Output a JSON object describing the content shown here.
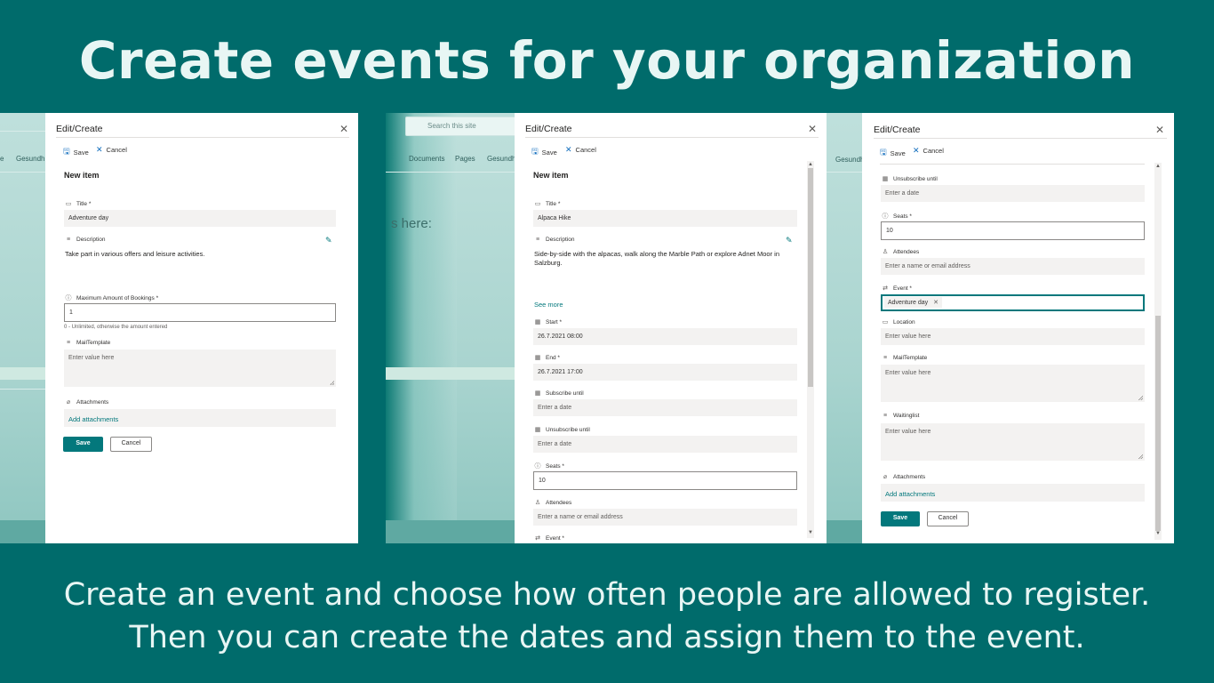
{
  "headline": "Create events for your organization",
  "subline": {
    "line1": "Create an event and choose how often people are allowed to register.",
    "line2": "Then you can create the dates and assign them to the event."
  },
  "background": {
    "search_placeholder": "Search this site",
    "nav": [
      "Gesundh",
      "Documents",
      "Pages",
      "Gesundh",
      "Gesundh"
    ],
    "heading_fragment": "s here:"
  },
  "common": {
    "panel_title": "Edit/Create",
    "save": "Save",
    "cancel": "Cancel",
    "new_item": "New item",
    "close_glyph": "✕"
  },
  "panel1": {
    "title_label": "Title *",
    "title_value": "Adventure day",
    "description_label": "Description",
    "description_value": "Take part in various offers and leisure activities.",
    "max_bookings_label": "Maximum Amount of Bookings *",
    "max_bookings_value": "1",
    "max_bookings_hint": "0 - Unlimited, otherwise the amount entered",
    "mailtemplate_label": "MailTemplate",
    "mailtemplate_placeholder": "Enter value here",
    "attachments_label": "Attachments",
    "add_attachments": "Add attachments"
  },
  "panel2": {
    "title_label": "Title *",
    "title_value": "Alpaca Hike",
    "description_label": "Description",
    "description_value": "Side-by-side with the alpacas, walk along the Marble Path or explore Adnet Moor in Salzburg.",
    "see_more": "See more",
    "start_label": "Start *",
    "start_value": "26.7.2021 08:00",
    "end_label": "End *",
    "end_value": "26.7.2021 17:00",
    "subscribe_label": "Subscribe until",
    "subscribe_placeholder": "Enter a date",
    "unsubscribe_label": "Unsubscribe until",
    "unsubscribe_placeholder": "Enter a date",
    "seats_label": "Seats *",
    "seats_value": "10",
    "attendees_label": "Attendees",
    "attendees_placeholder": "Enter a name or email address",
    "event_label": "Event *"
  },
  "panel3": {
    "unsubscribe_label": "Unsubscribe until",
    "unsubscribe_placeholder": "Enter a date",
    "seats_label": "Seats *",
    "seats_value": "10",
    "attendees_label": "Attendees",
    "attendees_placeholder": "Enter a name or email address",
    "event_label": "Event *",
    "event_tag": "Adventure day",
    "location_label": "Location",
    "location_placeholder": "Enter value here",
    "mailtemplate_label": "MailTemplate",
    "mailtemplate_placeholder": "Enter value here",
    "waitinglist_label": "Waitinglist",
    "waitinglist_placeholder": "Enter value here",
    "attachments_label": "Attachments",
    "add_attachments": "Add attachments"
  },
  "colors": {
    "background": "#006b6b",
    "accent": "#03787c",
    "headline_text": "#e8f6f4"
  }
}
